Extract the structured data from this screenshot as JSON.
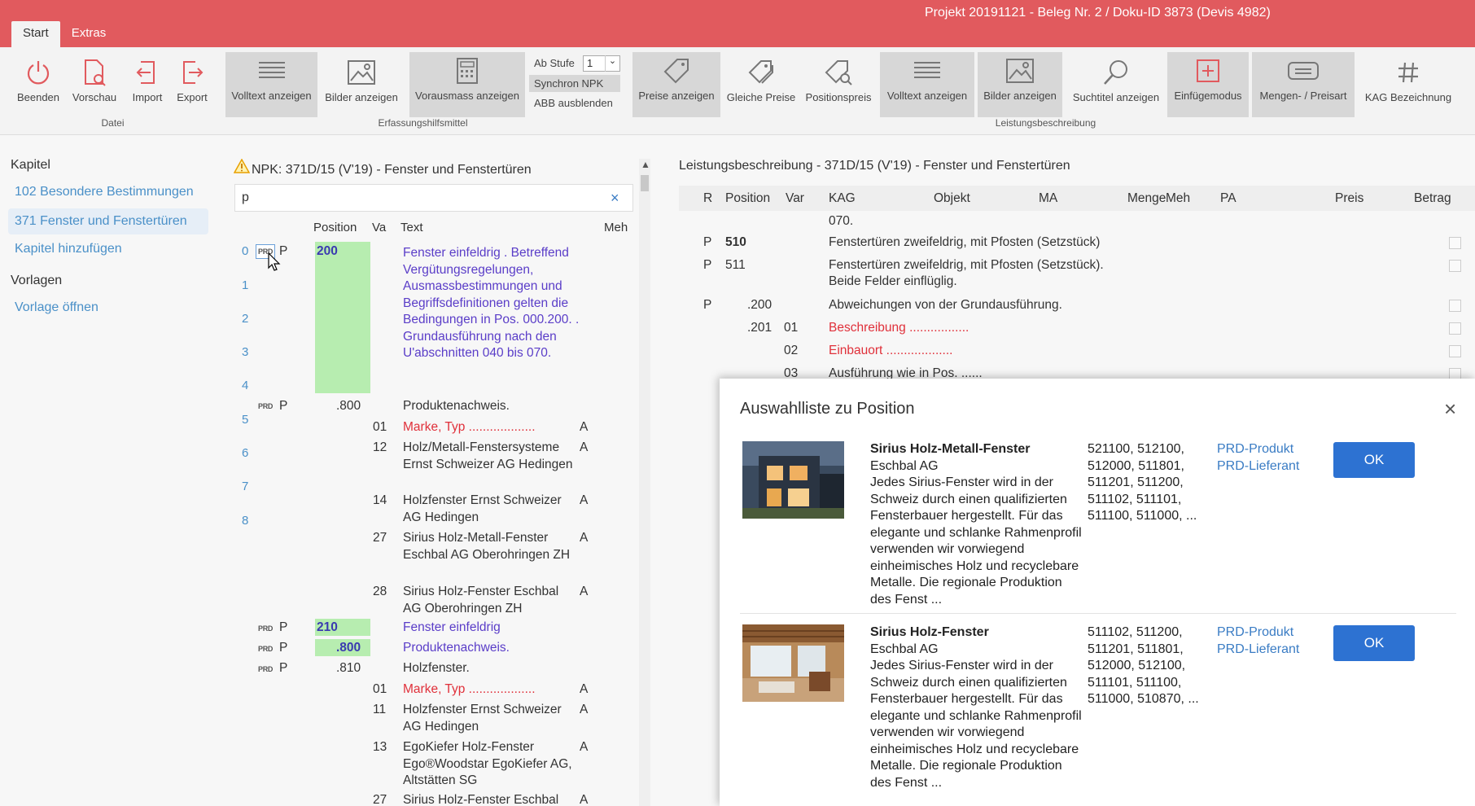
{
  "window": {
    "title": "Projekt 20191121 - Beleg Nr. 2 / Doku-ID 3873 (Devis 4982)"
  },
  "tabs": [
    "Start",
    "Extras"
  ],
  "ribbon": {
    "buttons": {
      "beenden": "Beenden",
      "vorschau": "Vorschau",
      "import": "Import",
      "export": "Export",
      "volltext1": "Volltext anzeigen",
      "bilder1": "Bilder anzeigen",
      "vorausmass": "Vorausmass anzeigen",
      "preise": "Preise anzeigen",
      "gleiche": "Gleiche Preise",
      "positionspreis": "Positionspreis",
      "volltext2": "Volltext anzeigen",
      "bilder2": "Bilder anzeigen",
      "suchtitel": "Suchtitel anzeigen",
      "einfuege": "Einfügemodus",
      "mengen": "Mengen- / Preisart",
      "kag": "KAG Bezeichnung"
    },
    "ab_stufe_label": "Ab Stufe",
    "ab_stufe_value": "1",
    "synchron": "Synchron NPK",
    "abb": "ABB ausblenden",
    "groups": {
      "datei": "Datei",
      "erfassung": "Erfassungshilfsmittel",
      "leistung": "Leistungsbeschreibung"
    }
  },
  "sidebar": {
    "kapitel_heading": "Kapitel",
    "items": [
      "102 Besondere Bestimmungen",
      "371 Fenster und Fenstertüren",
      "Kapitel hinzufügen"
    ],
    "vorlagen_heading": "Vorlagen",
    "vorlagen_items": [
      "Vorlage öffnen"
    ]
  },
  "npk": {
    "title": "NPK: 371D/15 (V'19) - Fenster und Fenstertüren",
    "search_value": "p",
    "search_clear": "×",
    "columns": [
      "Position",
      "Va",
      "Text",
      "Meh"
    ],
    "row_numbers": [
      "0",
      "1",
      "2",
      "3",
      "4",
      "5",
      "6",
      "7",
      "8"
    ],
    "prd": "PRD",
    "p": "P",
    "rows": {
      "r200_pos": "200",
      "r200_text": "Fenster einfeldrig . Betreffend Vergütungsregelungen, Ausmassbestimmungen und Begriffsdefinitionen gelten die Bedingungen in Pos. 000.200. . Grundausführung nach den U'abschnitten 040 bis 070.",
      "r800_pos": ".800",
      "r800_text": "Produktenachweis.",
      "v01": "01",
      "v01_text": "Marke, Typ ...................",
      "v01_meh": "A",
      "v12": "12",
      "v12_text": "Holz/Metall-Fenstersysteme Ernst Schweizer AG Hedingen",
      "v12_meh": "A",
      "v14": "14",
      "v14_text": "Holzfenster Ernst Schweizer AG Hedingen",
      "v14_meh": "A",
      "v27": "27",
      "v27_text": "Sirius Holz-Metall-Fenster Eschbal AG Oberohringen ZH",
      "v27_meh": "A",
      "v28": "28",
      "v28_text": "Sirius Holz-Fenster Eschbal AG Oberohringen ZH",
      "v28_meh": "A",
      "r210_pos": "210",
      "r210_text": "Fenster einfeldrig",
      "r210800_pos": ".800",
      "r210800_text": "Produktenachweis.",
      "r810_pos": ".810",
      "r810_text": "Holzfenster.",
      "w01": "01",
      "w01_text": "Marke, Typ ...................",
      "w01_meh": "A",
      "w11": "11",
      "w11_text": "Holzfenster Ernst Schweizer AG Hedingen",
      "w11_meh": "A",
      "w13": "13",
      "w13_text": "EgoKiefer Holz-Fenster Ego®Woodstar EgoKiefer AG, Altstätten SG",
      "w13_meh": "A",
      "w27": "27",
      "w27_text": "Sirius Holz-Fenster Eschbal",
      "w27_meh": "A"
    }
  },
  "lb": {
    "title": "Leistungsbeschreibung - 371D/15 (V'19) - Fenster und Fenstertüren",
    "columns": [
      "R",
      "Position",
      "Var",
      "KAG",
      "Objekt",
      "MA",
      "Menge",
      "Meh",
      "PA",
      "Preis",
      "Betrag"
    ],
    "rows": {
      "top_text": "070.",
      "r510_r": "P",
      "r510_pos": "510",
      "r510_text": "Fenstertüren zweifeldrig, mit Pfosten (Setzstück)",
      "r511_r": "P",
      "r511_pos": "511",
      "r511_text": "Fenstertüren zweifeldrig, mit Pfosten (Setzstück). Beide Felder einflüglig.",
      "r200_r": "P",
      "r200_pos": ".200",
      "r200_text": "Abweichungen von der Grundausführung.",
      "r201_pos": ".201",
      "r201_var": "01",
      "r201_text": "Beschreibung .................",
      "v02": "02",
      "v02_text": "Einbauort ...................",
      "v03": "03",
      "v03_text": "Ausführung wie in Pos. ......"
    }
  },
  "modal": {
    "title": "Auswahlliste zu Position",
    "close": "×",
    "items": [
      {
        "name": "Sirius Holz-Metall-Fenster",
        "company": "Eschbal AG",
        "desc": "Jedes Sirius-Fenster wird in der Schweiz durch einen qualifizierten Fensterbauer hergestellt. Für das elegante und schlanke Rahmenprofil verwenden wir vorwiegend einheimisches Holz und recyclebare Metalle. Die regionale Produktion des Fenst ...",
        "codes": "521100, 512100, 512000, 511801, 511201, 511200, 511102, 511101, 511100, 511000, ...",
        "link1": "PRD-Produkt",
        "link2": "PRD-Lieferant",
        "ok": "OK"
      },
      {
        "name": "Sirius Holz-Fenster",
        "company": "Eschbal AG",
        "desc": "Jedes Sirius-Fenster wird in der Schweiz durch einen qualifizierten Fensterbauer hergestellt. Für das elegante und schlanke Rahmenprofil verwenden wir vorwiegend einheimisches Holz und recyclebare Metalle. Die regionale Produktion des Fenst ...",
        "codes": "511102, 511200, 511201, 511801, 512000, 512100, 511101, 511100, 511000, 510870, ...",
        "link1": "PRD-Produkt",
        "link2": "PRD-Lieferant",
        "ok": "OK"
      }
    ]
  },
  "colors": {
    "titlebar": "#e15a5e",
    "link": "#4a90c8",
    "ok": "#2d72d2",
    "green": "#b7edb0",
    "red": "#e0303a",
    "blue": "#5a3dc8"
  }
}
